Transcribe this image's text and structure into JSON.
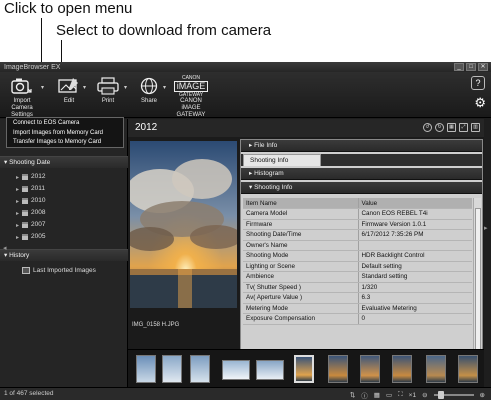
{
  "callouts": {
    "open_menu": "Click to open menu",
    "select_download": "Select to download from camera"
  },
  "window": {
    "title": "ImageBrowser EX",
    "minimize": "_",
    "maximize": "□",
    "close": "✕"
  },
  "toolbar": {
    "import_label_1": "Import",
    "import_label_2": "Camera Settings",
    "edit_label": "Edit",
    "print_label": "Print",
    "share_label": "Share",
    "gateway_label_1": "CANON iMAGE",
    "gateway_label_2": "GATEWAY",
    "gateway_logo_1": "CANON",
    "gateway_logo_2": "iMAGE",
    "gateway_logo_3": "GATEWAY",
    "help": "?",
    "settings": "⚙"
  },
  "dropdown": {
    "items": [
      "Connect to EOS Camera",
      "Import Images from Memory Card",
      "Transfer Images to Memory Card"
    ]
  },
  "sidebar": {
    "shooting_date_header": "Shooting Date",
    "years": [
      "2012",
      "2011",
      "2010",
      "2008",
      "2007",
      "2005"
    ],
    "history_header": "History",
    "history_items": [
      "Last Imported Images"
    ]
  },
  "main": {
    "folder_title": "2012",
    "photo_caption": "IMG_0158 H.JPG"
  },
  "info_panel": {
    "file_info": "File Info",
    "tab_shooting_info": "Shooting Info",
    "histogram": "Histogram",
    "shooting_info_header": "Shooting Info",
    "columns": [
      "Item Name",
      "Value"
    ],
    "rows": [
      [
        "Camera Model",
        "Canon EOS REBEL T4i"
      ],
      [
        "Firmware",
        "Firmware Version 1.0.1"
      ],
      [
        "Shooting Date/Time",
        "6/17/2012 7:35:26 PM"
      ],
      [
        "Owner's Name",
        ""
      ],
      [
        "Shooting Mode",
        "HDR Backlight Control"
      ],
      [
        "Lighting or Scene",
        "Default setting"
      ],
      [
        "Ambience",
        "Standard setting"
      ],
      [
        "Tv( Shutter Speed )",
        "1/320"
      ],
      [
        "Av( Aperture Value )",
        "6.3"
      ],
      [
        "Metering Mode",
        "Evaluative Metering"
      ],
      [
        "Exposure Compensation",
        "0"
      ]
    ]
  },
  "status": {
    "selection": "1 of 467 selected",
    "zoom": "×1"
  },
  "colors": {
    "app_bg": "#1e1e1e",
    "panel_bg": "#cfcfcf",
    "dropdown_border": "#666666"
  }
}
